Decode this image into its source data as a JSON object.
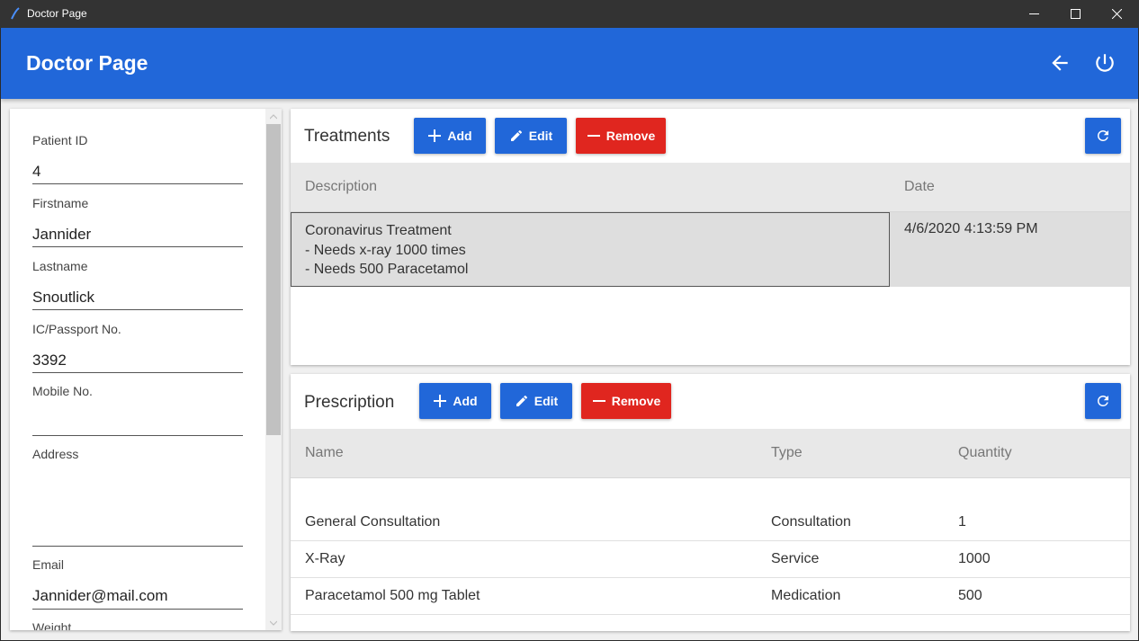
{
  "window": {
    "title": "Doctor Page"
  },
  "appbar": {
    "title": "Doctor Page"
  },
  "patient": {
    "fields": [
      {
        "label": "Patient ID",
        "value": "4"
      },
      {
        "label": "Firstname",
        "value": "Jannider"
      },
      {
        "label": "Lastname",
        "value": "Snoutlick"
      },
      {
        "label": "IC/Passport No.",
        "value": "3392"
      },
      {
        "label": "Mobile No.",
        "value": ""
      },
      {
        "label": "Address",
        "value": ""
      },
      {
        "label": "Email",
        "value": "Jannider@mail.com"
      },
      {
        "label": "Weight",
        "value": ""
      }
    ]
  },
  "treatments": {
    "title": "Treatments",
    "add_label": "Add",
    "edit_label": "Edit",
    "remove_label": "Remove",
    "columns": {
      "description": "Description",
      "date": "Date"
    },
    "rows": [
      {
        "description_lines": [
          "Coronavirus Treatment",
          "- Needs x-ray 1000 times",
          "- Needs 500 Paracetamol"
        ],
        "date": "4/6/2020 4:13:59 PM"
      }
    ]
  },
  "prescription": {
    "title": "Prescription",
    "add_label": "Add",
    "edit_label": "Edit",
    "remove_label": "Remove",
    "columns": {
      "name": "Name",
      "type": "Type",
      "quantity": "Quantity"
    },
    "rows": [
      {
        "name": "General Consultation",
        "type": "Consultation",
        "quantity": "1"
      },
      {
        "name": "X-Ray",
        "type": "Service",
        "quantity": "1000"
      },
      {
        "name": "Paracetamol 500 mg Tablet",
        "type": "Medication",
        "quantity": "500"
      }
    ]
  },
  "icons": {
    "back": "arrow-left-icon",
    "power": "power-icon",
    "add": "plus-icon",
    "edit": "pencil-icon",
    "remove": "minus-icon",
    "refresh": "refresh-icon"
  },
  "colors": {
    "primary": "#2167d9",
    "danger": "#e0261f",
    "titlebar": "#333333"
  }
}
